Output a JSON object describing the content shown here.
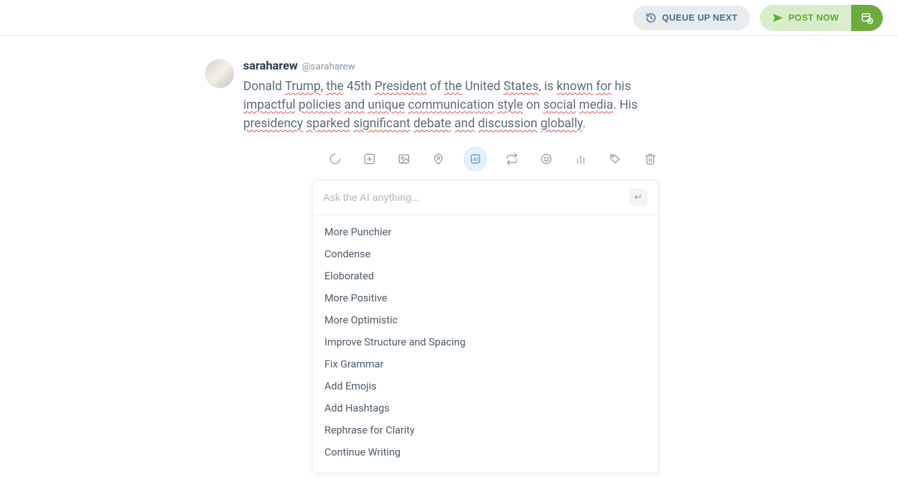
{
  "header": {
    "queue_label": "QUEUE UP NEXT",
    "post_label": "POST NOW"
  },
  "composer": {
    "username": "saraharew",
    "handle": "@saraharew",
    "text_segments": [
      {
        "t": "Donald ",
        "sp": false
      },
      {
        "t": "Trump",
        "sp": true
      },
      {
        "t": ", ",
        "sp": false
      },
      {
        "t": "the",
        "sp": true
      },
      {
        "t": " 45th ",
        "sp": false
      },
      {
        "t": "President",
        "sp": true
      },
      {
        "t": " of ",
        "sp": false
      },
      {
        "t": "the",
        "sp": true
      },
      {
        "t": " United ",
        "sp": false
      },
      {
        "t": "States",
        "sp": true
      },
      {
        "t": ", is ",
        "sp": false
      },
      {
        "t": "known",
        "sp": true
      },
      {
        "t": " ",
        "sp": false
      },
      {
        "t": "for",
        "sp": true
      },
      {
        "t": " his ",
        "sp": false
      },
      {
        "t": "impactful",
        "sp": true
      },
      {
        "t": " ",
        "sp": false
      },
      {
        "t": "policies",
        "sp": true
      },
      {
        "t": " ",
        "sp": false
      },
      {
        "t": "and",
        "sp": true
      },
      {
        "t": " ",
        "sp": false
      },
      {
        "t": "unique",
        "sp": true
      },
      {
        "t": " ",
        "sp": false
      },
      {
        "t": "communication",
        "sp": true
      },
      {
        "t": " ",
        "sp": false
      },
      {
        "t": "style",
        "sp": true
      },
      {
        "t": " on ",
        "sp": false
      },
      {
        "t": "social",
        "sp": true
      },
      {
        "t": " ",
        "sp": false
      },
      {
        "t": "media",
        "sp": true
      },
      {
        "t": ". His ",
        "sp": false
      },
      {
        "t": "presidency",
        "sp": true
      },
      {
        "t": " ",
        "sp": false
      },
      {
        "t": "sparked",
        "sp": true
      },
      {
        "t": " ",
        "sp": false
      },
      {
        "t": "significant",
        "sp": true
      },
      {
        "t": " ",
        "sp": false
      },
      {
        "t": "debate",
        "sp": true
      },
      {
        "t": " ",
        "sp": false
      },
      {
        "t": "and",
        "sp": true
      },
      {
        "t": " ",
        "sp": false
      },
      {
        "t": "discussion",
        "sp": true
      },
      {
        "t": " ",
        "sp": false
      },
      {
        "t": "globally",
        "sp": true
      },
      {
        "t": ".",
        "sp": false
      }
    ]
  },
  "ai": {
    "placeholder": "Ask the AI anything...",
    "suggestions": [
      "More Punchier",
      "Condense",
      "Eloborated",
      "More Positive",
      "More Optimistic",
      "Improve Structure and Spacing",
      "Fix Grammar",
      "Add Emojis",
      "Add Hashtags",
      "Rephrase for Clarity",
      "Continue Writing"
    ]
  }
}
